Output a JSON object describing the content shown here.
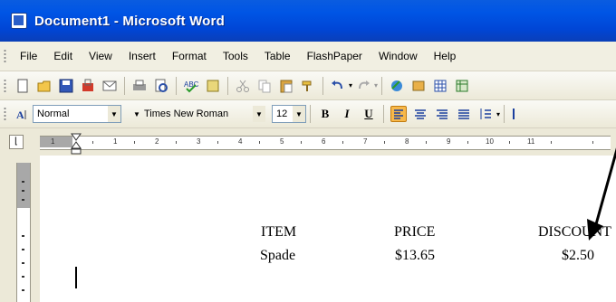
{
  "window": {
    "title": "Document1 - Microsoft Word"
  },
  "menu": {
    "items": [
      "File",
      "Edit",
      "View",
      "Insert",
      "Format",
      "Tools",
      "Table",
      "FlashPaper",
      "Window",
      "Help"
    ]
  },
  "formatting": {
    "style": "Normal",
    "font": "Times New Roman",
    "size": "12",
    "bold": "B",
    "italic": "I",
    "underline": "U"
  },
  "document": {
    "headers": [
      "ITEM",
      "PRICE",
      "DISCOUNT"
    ],
    "rows": [
      [
        "Spade",
        "$13.65",
        "$2.50"
      ]
    ]
  },
  "ruler": {
    "numbers": [
      "1",
      "1",
      "2",
      "3",
      "4",
      "5",
      "6",
      "7",
      "8",
      "9",
      "10",
      "11"
    ]
  },
  "colors": {
    "titlebar": "#0055e5",
    "toolbar": "#ece9d8",
    "menubar": "#f1efe2"
  },
  "icons": [
    "new-document-icon",
    "open-icon",
    "save-icon",
    "permission-icon",
    "email-icon",
    "print-icon",
    "print-preview-icon",
    "spelling-icon",
    "research-icon",
    "cut-icon",
    "copy-icon",
    "paste-icon",
    "format-painter-icon",
    "undo-icon",
    "redo-icon",
    "hyperlink-icon",
    "tables-borders-icon",
    "insert-table-icon",
    "insert-excel-icon"
  ]
}
